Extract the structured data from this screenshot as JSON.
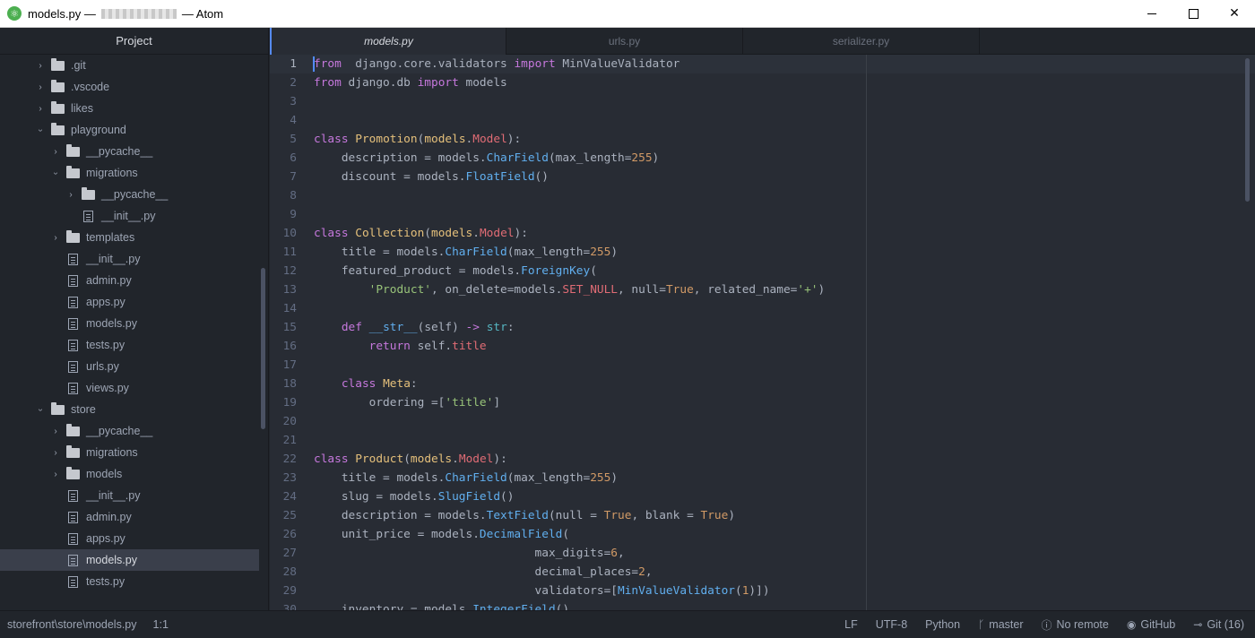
{
  "window": {
    "title_file": "models.py —",
    "title_app": "— Atom"
  },
  "sidebar": {
    "header": "Project",
    "items": [
      {
        "label": ".git",
        "type": "folder",
        "depth": 0,
        "state": "closed"
      },
      {
        "label": ".vscode",
        "type": "folder",
        "depth": 0,
        "state": "closed"
      },
      {
        "label": "likes",
        "type": "folder",
        "depth": 0,
        "state": "closed"
      },
      {
        "label": "playground",
        "type": "folder",
        "depth": 0,
        "state": "open"
      },
      {
        "label": "__pycache__",
        "type": "folder",
        "depth": 1,
        "state": "closed"
      },
      {
        "label": "migrations",
        "type": "folder",
        "depth": 1,
        "state": "open"
      },
      {
        "label": "__pycache__",
        "type": "folder",
        "depth": 2,
        "state": "closed"
      },
      {
        "label": "__init__.py",
        "type": "file",
        "depth": 2
      },
      {
        "label": "templates",
        "type": "folder",
        "depth": 1,
        "state": "closed"
      },
      {
        "label": "__init__.py",
        "type": "file",
        "depth": 1
      },
      {
        "label": "admin.py",
        "type": "file",
        "depth": 1
      },
      {
        "label": "apps.py",
        "type": "file",
        "depth": 1
      },
      {
        "label": "models.py",
        "type": "file",
        "depth": 1
      },
      {
        "label": "tests.py",
        "type": "file",
        "depth": 1
      },
      {
        "label": "urls.py",
        "type": "file",
        "depth": 1
      },
      {
        "label": "views.py",
        "type": "file",
        "depth": 1
      },
      {
        "label": "store",
        "type": "folder",
        "depth": 0,
        "state": "open"
      },
      {
        "label": "__pycache__",
        "type": "folder",
        "depth": 1,
        "state": "closed"
      },
      {
        "label": "migrations",
        "type": "folder",
        "depth": 1,
        "state": "closed"
      },
      {
        "label": "models",
        "type": "folder",
        "depth": 1,
        "state": "closed"
      },
      {
        "label": "__init__.py",
        "type": "file",
        "depth": 1
      },
      {
        "label": "admin.py",
        "type": "file",
        "depth": 1
      },
      {
        "label": "apps.py",
        "type": "file",
        "depth": 1
      },
      {
        "label": "models.py",
        "type": "file",
        "depth": 1,
        "selected": true
      },
      {
        "label": "tests.py",
        "type": "file",
        "depth": 1
      }
    ]
  },
  "tabs": [
    {
      "label": "models.py",
      "active": true
    },
    {
      "label": "urls.py",
      "active": false
    },
    {
      "label": "serializer.py",
      "active": false
    }
  ],
  "code": {
    "lines": [
      [
        [
          "kw",
          "from"
        ],
        [
          "",
          "  django.core.validators "
        ],
        [
          "kw",
          "import"
        ],
        [
          "",
          " MinValueValidator"
        ]
      ],
      [
        [
          "kw",
          "from"
        ],
        [
          "",
          " django.db "
        ],
        [
          "kw",
          "import"
        ],
        [
          "",
          " models"
        ]
      ],
      [],
      [],
      [
        [
          "kw",
          "class"
        ],
        [
          "",
          " "
        ],
        [
          "cls",
          "Promotion"
        ],
        [
          "",
          "("
        ],
        [
          "cls",
          "models"
        ],
        [
          "",
          "."
        ],
        [
          "red",
          "Model"
        ],
        [
          "",
          "):"
        ]
      ],
      [
        [
          "",
          "    description = models."
        ],
        [
          "fn",
          "CharField"
        ],
        [
          "",
          "(max_length="
        ],
        [
          "num",
          "255"
        ],
        [
          "",
          ")"
        ]
      ],
      [
        [
          "",
          "    discount = models."
        ],
        [
          "fn",
          "FloatField"
        ],
        [
          "",
          "()"
        ]
      ],
      [],
      [],
      [
        [
          "kw",
          "class"
        ],
        [
          "",
          " "
        ],
        [
          "cls",
          "Collection"
        ],
        [
          "",
          "("
        ],
        [
          "cls",
          "models"
        ],
        [
          "",
          "."
        ],
        [
          "red",
          "Model"
        ],
        [
          "",
          "):"
        ]
      ],
      [
        [
          "",
          "    title = models."
        ],
        [
          "fn",
          "CharField"
        ],
        [
          "",
          "(max_length="
        ],
        [
          "num",
          "255"
        ],
        [
          "",
          ")"
        ]
      ],
      [
        [
          "",
          "    featured_product = models."
        ],
        [
          "fn",
          "ForeignKey"
        ],
        [
          "",
          "("
        ]
      ],
      [
        [
          "",
          "        "
        ],
        [
          "str",
          "'Product'"
        ],
        [
          "",
          ", on_delete=models."
        ],
        [
          "red",
          "SET_NULL"
        ],
        [
          "",
          ", null="
        ],
        [
          "num",
          "True"
        ],
        [
          "",
          ", related_name="
        ],
        [
          "str",
          "'+'"
        ],
        [
          "",
          ")"
        ]
      ],
      [],
      [
        [
          "",
          "    "
        ],
        [
          "kw",
          "def"
        ],
        [
          "",
          " "
        ],
        [
          "fn",
          "__str__"
        ],
        [
          "",
          "(self) "
        ],
        [
          "kw",
          "->"
        ],
        [
          "",
          " "
        ],
        [
          "op",
          "str"
        ],
        [
          "",
          ":"
        ]
      ],
      [
        [
          "",
          "        "
        ],
        [
          "kw",
          "return"
        ],
        [
          "",
          " self."
        ],
        [
          "red",
          "title"
        ]
      ],
      [],
      [
        [
          "",
          "    "
        ],
        [
          "kw",
          "class"
        ],
        [
          "",
          " "
        ],
        [
          "cls",
          "Meta"
        ],
        [
          "",
          ":"
        ]
      ],
      [
        [
          "",
          "        ordering =["
        ],
        [
          "str",
          "'title'"
        ],
        [
          "",
          "]"
        ]
      ],
      [],
      [],
      [
        [
          "kw",
          "class"
        ],
        [
          "",
          " "
        ],
        [
          "cls",
          "Product"
        ],
        [
          "",
          "("
        ],
        [
          "cls",
          "models"
        ],
        [
          "",
          "."
        ],
        [
          "red",
          "Model"
        ],
        [
          "",
          "):"
        ]
      ],
      [
        [
          "",
          "    title = models."
        ],
        [
          "fn",
          "CharField"
        ],
        [
          "",
          "(max_length="
        ],
        [
          "num",
          "255"
        ],
        [
          "",
          ")"
        ]
      ],
      [
        [
          "",
          "    slug = models."
        ],
        [
          "fn",
          "SlugField"
        ],
        [
          "",
          "()"
        ]
      ],
      [
        [
          "",
          "    description = models."
        ],
        [
          "fn",
          "TextField"
        ],
        [
          "",
          "(null = "
        ],
        [
          "num",
          "True"
        ],
        [
          "",
          ", blank = "
        ],
        [
          "num",
          "True"
        ],
        [
          "",
          ")"
        ]
      ],
      [
        [
          "",
          "    unit_price = models."
        ],
        [
          "fn",
          "DecimalField"
        ],
        [
          "",
          "("
        ]
      ],
      [
        [
          "",
          "                                max_digits="
        ],
        [
          "num",
          "6"
        ],
        [
          "",
          ","
        ]
      ],
      [
        [
          "",
          "                                decimal_places="
        ],
        [
          "num",
          "2"
        ],
        [
          "",
          ","
        ]
      ],
      [
        [
          "",
          "                                validators=["
        ],
        [
          "fn",
          "MinValueValidator"
        ],
        [
          "",
          "("
        ],
        [
          "num",
          "1"
        ],
        [
          "",
          ")])"
        ]
      ],
      [
        [
          "",
          "    inventory = models."
        ],
        [
          "fn",
          "IntegerField"
        ],
        [
          "",
          "()"
        ]
      ]
    ]
  },
  "status": {
    "path": "storefront\\store\\models.py",
    "cursor": "1:1",
    "line_ending": "LF",
    "encoding": "UTF-8",
    "grammar": "Python",
    "branch": "master",
    "remote": "No remote",
    "github": "GitHub",
    "git": "Git (16)"
  },
  "colors": {
    "accent": "#568af2",
    "keyword": "#c678dd",
    "class": "#e5c07b",
    "function": "#61afef",
    "number": "#d19a66",
    "string": "#98c379"
  }
}
